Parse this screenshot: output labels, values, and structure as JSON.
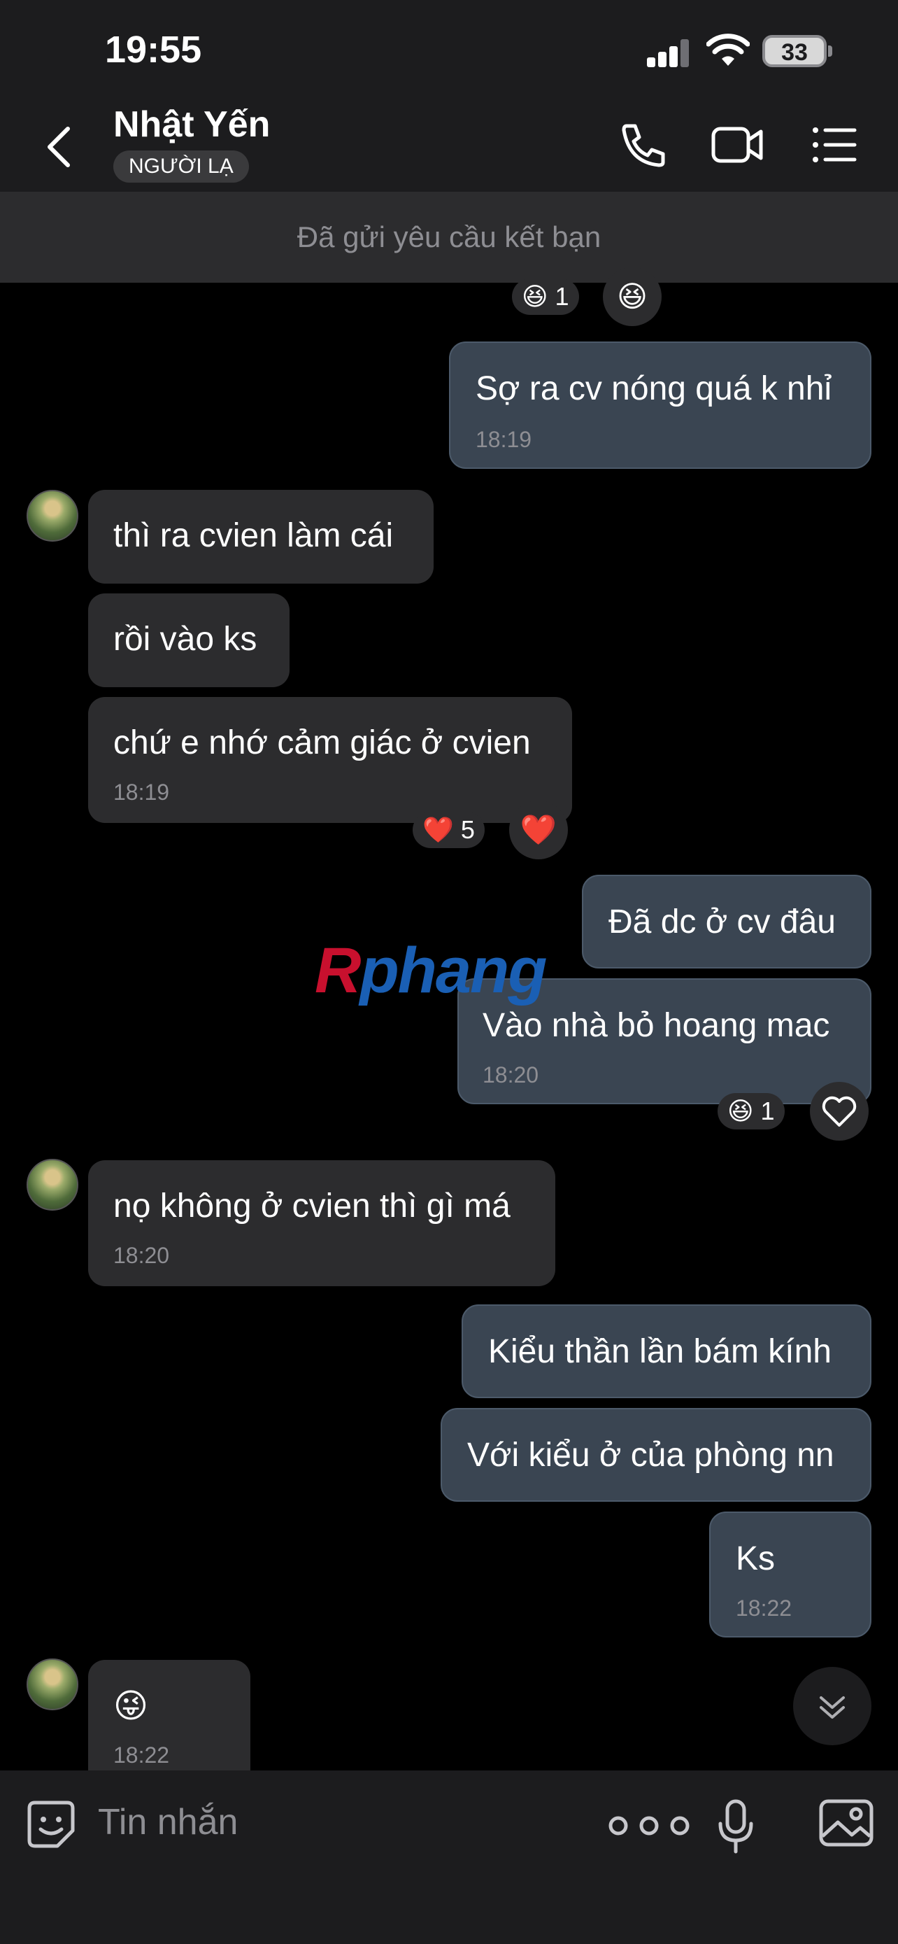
{
  "status_bar": {
    "time": "19:55",
    "battery": "33"
  },
  "header": {
    "contact_name": "Nhật Yến",
    "badge": "NGƯỜI LẠ"
  },
  "banner": {
    "text": "Đã gửi yêu cầu kết bạn"
  },
  "top_reactions": {
    "pill_count": "1",
    "pill_emoji": "😆",
    "circle_emoji": "😆"
  },
  "messages": [
    {
      "dir": "out",
      "text": "Sợ ra cv nóng quá k nhỉ",
      "time": "18:19"
    },
    {
      "dir": "in",
      "text": "thì ra cvien làm cái"
    },
    {
      "dir": "in",
      "text": "rồi vào ks"
    },
    {
      "dir": "in",
      "text": "chứ e nhớ cảm giác ở cvien",
      "time": "18:19",
      "reaction_emoji": "❤️",
      "reaction_count": "5",
      "react_button": "❤️"
    },
    {
      "dir": "out",
      "text": "Đã dc ở cv đâu"
    },
    {
      "dir": "out",
      "text": "Vào nhà bỏ hoang mac",
      "time": "18:20",
      "reaction_emoji": "😆",
      "reaction_count": "1",
      "react_button_icon": "heart-outline-icon"
    },
    {
      "dir": "in",
      "text": "nọ không ở cvien thì gì má",
      "time": "18:20"
    },
    {
      "dir": "out",
      "text": "Kiểu thần lần bám kính"
    },
    {
      "dir": "out",
      "text": "Với kiểu ở của phòng nn"
    },
    {
      "dir": "out",
      "text": "Ks",
      "time": "18:22"
    },
    {
      "dir": "in",
      "text": "😜",
      "time": "18:22"
    }
  ],
  "watermark": {
    "part1": "R",
    "part2": "phang"
  },
  "input": {
    "placeholder": "Tin nhắn"
  },
  "icons": [
    "back-chevron-icon",
    "phone-icon",
    "video-camera-icon",
    "list-menu-icon",
    "sticker-icon",
    "more-dots-icon",
    "voice-mic-icon",
    "image-icon",
    "chevron-double-down-icon"
  ],
  "colors": {
    "incoming_bubble": "#2c2c2e",
    "outgoing_bubble": "#3a4552",
    "header_bg": "#1c1c1e"
  }
}
